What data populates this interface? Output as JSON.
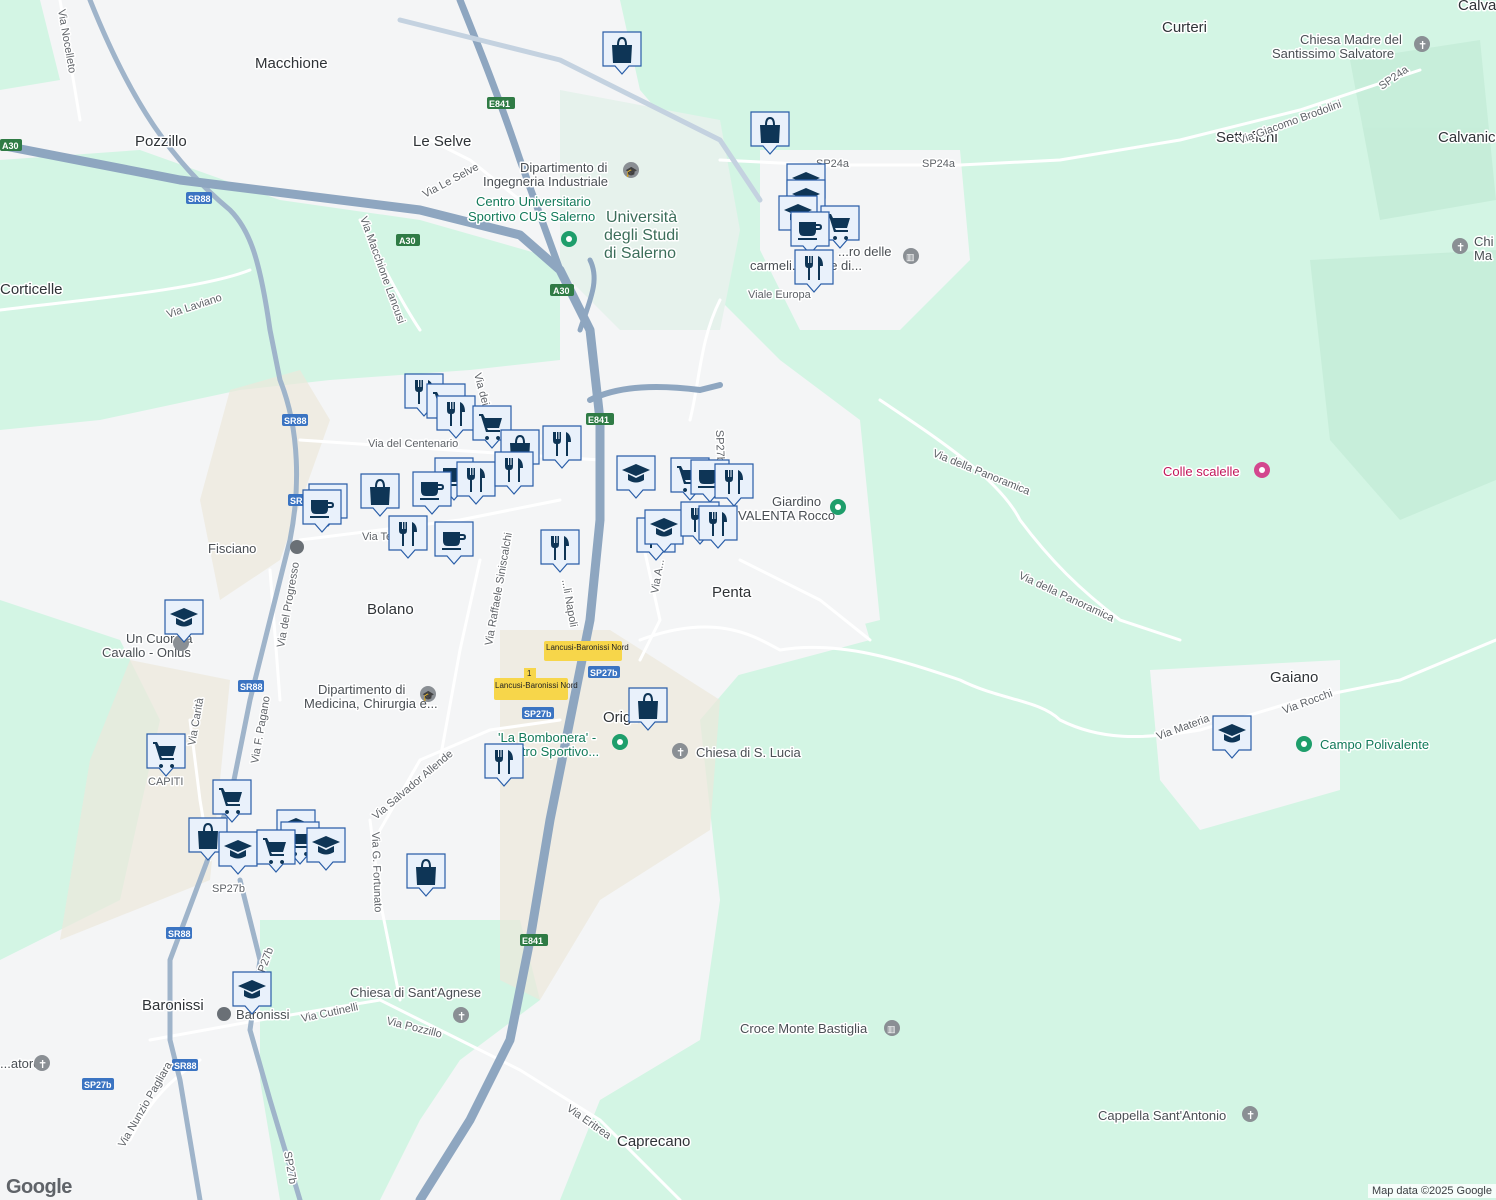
{
  "map": {
    "colors": {
      "background": "#f4f5f6",
      "green": "#d3f5e4",
      "highway": "#8ea6c0",
      "road": "#ffffff",
      "campus": "#e2efe9",
      "urban": "#f2efe7"
    },
    "attribution": "Map data ©2025 Google",
    "logo": "Google",
    "towns": [
      {
        "name": "Macchione"
      },
      {
        "name": "Pozzillo"
      },
      {
        "name": "Le Selve"
      },
      {
        "name": "Corticelle"
      },
      {
        "name": "Curteri"
      },
      {
        "name": "Settefichi"
      },
      {
        "name": "Calvanico"
      },
      {
        "name": "Calva"
      },
      {
        "name": "Bolano"
      },
      {
        "name": "Penta"
      },
      {
        "name": "Gaiano"
      },
      {
        "name": "Baronissi"
      },
      {
        "name": "Caprecano"
      },
      {
        "name": "Origlio"
      },
      {
        "name": "CAPITI"
      },
      {
        "name": "Fisciano"
      }
    ],
    "roads": [
      {
        "name": "Via Nocelleto"
      },
      {
        "name": "Via Le Selve"
      },
      {
        "name": "Via Macchione Lancusi"
      },
      {
        "name": "Via Laviano"
      },
      {
        "name": "Via del Centenario"
      },
      {
        "name": "Via dei S..."
      },
      {
        "name": "Via Te..."
      },
      {
        "name": "Via del Progresso"
      },
      {
        "name": "Via Raffaele Siniscalchi"
      },
      {
        "name": "Via F. Pagano"
      },
      {
        "name": "Via Salvador Allende"
      },
      {
        "name": "Via G. Fortunato"
      },
      {
        "name": "Via Carità"
      },
      {
        "name": "Via Cutinelli"
      },
      {
        "name": "Via Pozzillo"
      },
      {
        "name": "Via Nunzio Pagliara"
      },
      {
        "name": "Via Eritrea"
      },
      {
        "name": "Via della Panoramica"
      },
      {
        "name": "Via Giacomo Brodolini"
      },
      {
        "name": "Via Materia"
      },
      {
        "name": "Via Rocchi"
      },
      {
        "name": "Viale Europa"
      },
      {
        "name": "Via A..."
      },
      {
        "name": "...li Napoli"
      },
      {
        "name": "SP24a"
      },
      {
        "name": "SP27b"
      }
    ],
    "shields": [
      {
        "code": "A30"
      },
      {
        "code": "E841"
      },
      {
        "code": "SR88"
      },
      {
        "code": "SP27b"
      },
      {
        "code": "SP24a"
      }
    ],
    "exits": [
      {
        "label": "Lancusi-Baronissi Nord"
      },
      {
        "label": "1"
      }
    ],
    "pois": [
      {
        "name": "Dipartimento di Ingegneria Industriale",
        "icon": "graduation-cap-icon"
      },
      {
        "name": "Centro Universitario Sportivo CUS Salerno",
        "icon": "sports-pin-icon"
      },
      {
        "name": "Università degli Studi di Salerno",
        "icon": "university-label"
      },
      {
        "name": "Chiesa Madre del Santissimo Salvatore",
        "icon": "church-icon"
      },
      {
        "name": "Colle scalelle",
        "icon": "camera-icon"
      },
      {
        "name": "Giardino VALENTA Rocco",
        "icon": "garden-icon"
      },
      {
        "name": "Un Cuore a Cavallo - Onlus",
        "icon": "place-icon"
      },
      {
        "name": "Dipartimento di Medicina, Chirurgia e...",
        "icon": "graduation-cap-icon"
      },
      {
        "name": "'La Bombonera' - Centro Sportivo...",
        "icon": "sports-pin-icon"
      },
      {
        "name": "Chiesa di S. Lucia",
        "icon": "church-icon"
      },
      {
        "name": "Campo Polivalente",
        "icon": "sports-pin-icon"
      },
      {
        "name": "Chiesa di Sant'Agnese",
        "icon": "church-icon"
      },
      {
        "name": "Croce Monte Bastiglia",
        "icon": "museum-icon"
      },
      {
        "name": "Cappella Sant'Antonio",
        "icon": "church-icon"
      },
      {
        "name": "carmeli...alzate di...",
        "icon": "museum-icon"
      },
      {
        "name": "...atore",
        "icon": "church-icon"
      },
      {
        "name": "Chi... Ma...",
        "icon": "church-icon"
      }
    ],
    "marker_types": [
      "restaurant-icon",
      "coffee-icon",
      "shopping-bag-icon",
      "shopping-cart-icon",
      "school-icon"
    ]
  }
}
